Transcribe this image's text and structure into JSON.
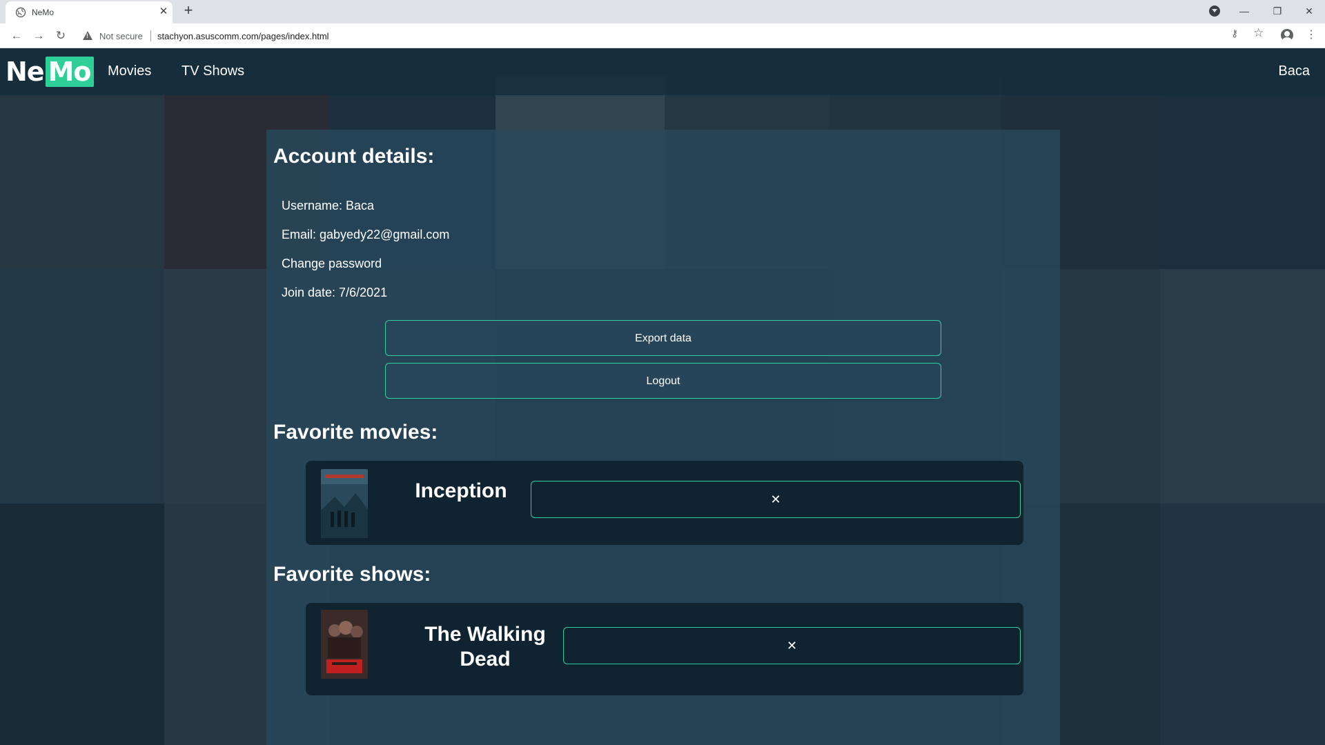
{
  "browser": {
    "tab_title": "NeMo",
    "not_secure_label": "Not secure",
    "url": "stachyon.asuscomm.com/pages/index.html"
  },
  "nav": {
    "logo_ne": "Ne",
    "logo_mo": "Mo",
    "links": [
      "Movies",
      "TV Shows"
    ],
    "user": "Baca"
  },
  "account": {
    "heading": "Account details:",
    "username": "Username: Baca",
    "email": "Email: gabyedy22@gmail.com",
    "change_password": "Change password",
    "join_date": "Join date: 7/6/2021",
    "export_label": "Export data",
    "logout_label": "Logout"
  },
  "favorites": {
    "movies_heading": "Favorite movies:",
    "movies": [
      {
        "title": "Inception",
        "remove_label": "✕"
      }
    ],
    "shows_heading": "Favorite shows:",
    "shows": [
      {
        "title_line1": "The Walking",
        "title_line2": "Dead",
        "remove_label": "✕"
      }
    ]
  },
  "colors": {
    "accent": "#2fcf98",
    "panel": "#28485c",
    "card": "#0f2330"
  }
}
